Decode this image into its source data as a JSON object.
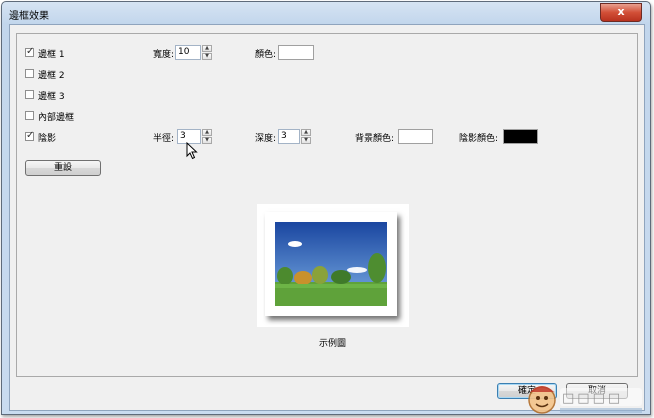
{
  "window": {
    "title": "邊框效果",
    "close_glyph": "x"
  },
  "options": {
    "border1": {
      "label": "邊框 1",
      "checked": true
    },
    "border2": {
      "label": "邊框 2",
      "checked": false
    },
    "border3": {
      "label": "邊框 3",
      "checked": false
    },
    "inner_border": {
      "label": "內部邊框",
      "checked": false
    },
    "shadow": {
      "label": "陰影",
      "checked": true
    }
  },
  "border_settings": {
    "width_label": "寬度:",
    "width_value": "10",
    "color_label": "顏色:",
    "color_value": "#ffffff"
  },
  "shadow_settings": {
    "radius_label": "半徑:",
    "radius_value": "3",
    "depth_label": "深度:",
    "depth_value": "3",
    "bg_color_label": "背景顏色:",
    "bg_color_value": "#ffffff",
    "shadow_color_label": "陰影顏色:",
    "shadow_color_value": "#000000"
  },
  "reset_label": "重設",
  "preview": {
    "caption": "示例圖"
  },
  "footer": {
    "ok_label": "確定",
    "cancel_label": "取消"
  },
  "colors": {
    "sky_top": "#1f4fa8",
    "sky_bottom": "#6aa2dd",
    "grass": "#5fa23a",
    "tree": "#3f7a2a"
  }
}
